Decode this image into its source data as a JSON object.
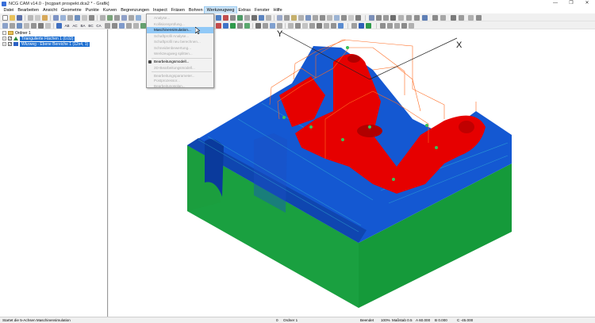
{
  "window": {
    "title": "NCG CAM v14.0 - [ncgpart prospekt.dca2 * - Grafik]",
    "controls": [
      "—",
      "❐",
      "✕"
    ]
  },
  "menubar": {
    "items": [
      "Datei",
      "Bearbeiten",
      "Ansicht",
      "Geometrie",
      "Punkte",
      "Kurven",
      "Begrenzungen",
      "Inspect",
      "Fräsen",
      "Bohren",
      "Werkzeugweg",
      "Extras",
      "Fenster",
      "Hilfe"
    ],
    "active_index": 10
  },
  "toolbar": {
    "view_labels": [
      "AB",
      "AC",
      "BA",
      "BC",
      "CA"
    ]
  },
  "tree": {
    "items": [
      {
        "label": "Ordner 1",
        "selected": false
      },
      {
        "label": "Triangulierte Flächen 1 (0.02)",
        "selected": true
      },
      {
        "label": "Wkzweg - Ebene Bereiche 1 (12x4, 1)",
        "selected": true
      }
    ]
  },
  "menu_werkzeugweg": {
    "items": [
      {
        "label": "Analyse...",
        "enabled": false
      },
      {
        "label": "Kollisionsprüfung...",
        "enabled": false
      },
      {
        "label": "Maschinensimulation...",
        "enabled": true,
        "highlighted": true
      },
      {
        "label": "Schaftprofil Analyse...",
        "enabled": false
      },
      {
        "label": "Schaftprofil neu berechnen...",
        "enabled": false
      },
      {
        "label": "Schneidenbewertung...",
        "enabled": false
      },
      {
        "label": "Werkzeugweg splitten...",
        "enabled": false
      },
      {
        "label": "Bearbeitungsmodell...",
        "enabled": true
      },
      {
        "label": "2D-Bearbeitungsmodell...",
        "enabled": false
      },
      {
        "label": "Bearbeitungsparameter...",
        "enabled": false
      },
      {
        "label": "Postprozessor...",
        "enabled": false
      },
      {
        "label": "Bearbeitungsplan...",
        "enabled": false
      }
    ]
  },
  "axes": {
    "y": "Y",
    "x": "X"
  },
  "statusbar": {
    "message": "Startet die 5-Achsen Maschinensimulation",
    "count": "0",
    "folder": "Ordner 1",
    "state": "Beendet",
    "zoom": "100%",
    "scale": "Maßstab 0.5",
    "a": "A 60.000",
    "b": "B 0.000",
    "c": "C -45.000"
  },
  "colors": {
    "part_red": "#e60000",
    "stock_blue": "#1458d2",
    "fixture_green": "#1a9a3c",
    "toolpath_orange": "#ff6a1f",
    "selection_blue": "#1d6fd1",
    "menu_highlight": "#91c9f7"
  }
}
